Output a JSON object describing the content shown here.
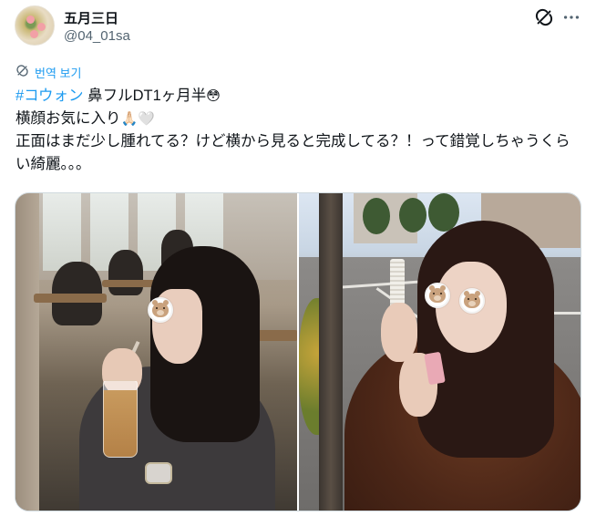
{
  "author": {
    "display_name": "五月三日",
    "handle": "@04_01sa"
  },
  "translate": {
    "label": "번역 보기",
    "icon": "grok-icon"
  },
  "tweet": {
    "hashtag": "#コウォン",
    "line1_rest": " 鼻フルDT1ヶ月半",
    "line1_emoji": "😳",
    "line2": "横顔お気に入り",
    "line2_emoji": "🙏🏻🤍",
    "line3": "正面はまだ少し腫れてる？けど横から見ると完成してる？！って錯覚しちゃうくらい綺麗。。。"
  },
  "media": {
    "photo_count": 2,
    "photo_1": "woman drinking iced coffee in cafe, face covered by bear sticker",
    "photo_2": "woman in brown fur coat holding comb on street, eyes covered by bear stickers"
  },
  "icons": {
    "grok": "grok-icon",
    "more": "more-icon",
    "translate": "translate-icon"
  },
  "colors": {
    "accent": "#1d9bf0",
    "text": "#0f1419",
    "secondary": "#536471"
  }
}
